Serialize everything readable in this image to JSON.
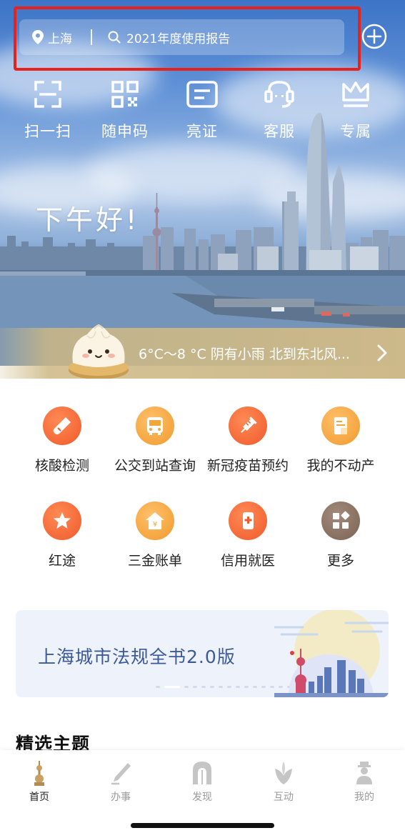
{
  "header": {
    "location": "上海",
    "search_text": "2021年度使用报告"
  },
  "quick_actions": [
    {
      "label": "扫一扫",
      "icon": "scan-icon"
    },
    {
      "label": "随申码",
      "icon": "qr-code-icon"
    },
    {
      "label": "亮证",
      "icon": "id-card-icon"
    },
    {
      "label": "客服",
      "icon": "headset-icon"
    },
    {
      "label": "专属",
      "icon": "crown-icon"
    }
  ],
  "greeting": "下午好!",
  "weather": {
    "text": "6°C～8 °C 阴有小雨 北到东北风..."
  },
  "services": [
    {
      "label": "核酸检测",
      "icon": "test-tube-icon",
      "color": "#f06a3a"
    },
    {
      "label": "公交到站查询",
      "icon": "bus-icon",
      "color": "#f3a63a"
    },
    {
      "label": "新冠疫苗预约",
      "icon": "syringe-icon",
      "color": "#f06a3a"
    },
    {
      "label": "我的不动产",
      "icon": "document-icon",
      "color": "#f3a63a"
    },
    {
      "label": "红途",
      "icon": "star-icon",
      "color": "#f06a3a"
    },
    {
      "label": "三金账单",
      "icon": "house-yen-icon",
      "color": "#f3a63a"
    },
    {
      "label": "信用就医",
      "icon": "phone-plus-icon",
      "color": "#f06a3a"
    },
    {
      "label": "更多",
      "icon": "grid-more-icon",
      "color": "#8c7568"
    }
  ],
  "banner": {
    "title": "上海城市法规全书2.0版"
  },
  "featured_section": {
    "title": "精选主题"
  },
  "tabbar": [
    {
      "label": "首页",
      "icon": "home-tower-icon",
      "active": true
    },
    {
      "label": "办事",
      "icon": "pen-icon",
      "active": false
    },
    {
      "label": "发现",
      "icon": "arch-icon",
      "active": false
    },
    {
      "label": "互动",
      "icon": "magnolia-icon",
      "active": false
    },
    {
      "label": "我的",
      "icon": "person-icon",
      "active": false
    }
  ]
}
